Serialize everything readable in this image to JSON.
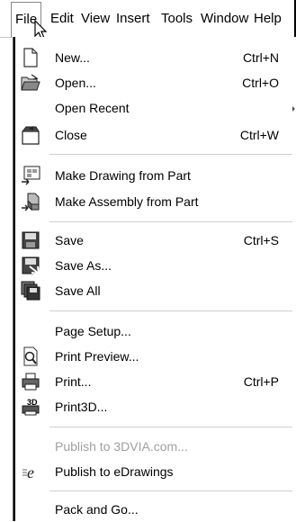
{
  "menubar": {
    "file": "File",
    "edit": "Edit",
    "view": "View",
    "insert": "Insert",
    "tools": "Tools",
    "window": "Window",
    "help": "Help"
  },
  "file_menu": {
    "new": {
      "label": "New...",
      "shortcut": "Ctrl+N"
    },
    "open": {
      "label": "Open...",
      "shortcut": "Ctrl+O"
    },
    "open_recent": {
      "label": "Open Recent"
    },
    "close": {
      "label": "Close",
      "shortcut": "Ctrl+W"
    },
    "make_drawing": {
      "label": "Make Drawing from Part"
    },
    "make_assembly": {
      "label": "Make Assembly from Part"
    },
    "save": {
      "label": "Save",
      "shortcut": "Ctrl+S"
    },
    "save_as": {
      "label": "Save As..."
    },
    "save_all": {
      "label": "Save All"
    },
    "page_setup": {
      "label": "Page Setup..."
    },
    "print_preview": {
      "label": "Print Preview..."
    },
    "print": {
      "label": "Print...",
      "shortcut": "Ctrl+P"
    },
    "print3d": {
      "label": "Print3D..."
    },
    "publish_3dvia": {
      "label": "Publish to 3DVIA.com..."
    },
    "publish_edrawings": {
      "label": "Publish to eDrawings"
    },
    "pack_and_go": {
      "label": "Pack and Go..."
    }
  },
  "icons": {
    "new": "new-document-icon",
    "open": "open-folder-icon",
    "close": "close-document-icon",
    "make_drawing": "make-drawing-icon",
    "make_assembly": "make-assembly-icon",
    "save": "floppy-disk-icon",
    "save_as": "save-as-icon",
    "save_all": "save-all-icon",
    "print_preview": "print-preview-icon",
    "print": "printer-icon",
    "print3d": "print3d-icon",
    "publish_edrawings": "edrawings-icon"
  },
  "print3d_badge": "3D",
  "edrawings_glyph": "e"
}
